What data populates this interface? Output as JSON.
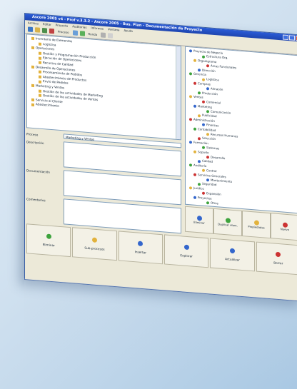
{
  "window": {
    "title": "Ascore 2005 v4 - Prof v.3.3.2 - Ascore 2005 - Bus. Plan - Documentación de Proyecto"
  },
  "menubar": [
    "Archivo",
    "Editar",
    "Proyecto",
    "Auditorías",
    "Informes",
    "Ventana",
    "Ayuda"
  ],
  "toolbar": {
    "text1": "Proceso",
    "text2": "Ronda"
  },
  "tree": [
    "Inventario de Elementos",
    "Logística",
    "Operaciones",
    "Gestión y Programación Producción",
    "Ejecución de Operaciones",
    "Recursos de Calidad",
    "Desarrollo de Operaciones",
    "Procesamiento de Pedidos",
    "Abastecimiento de Productos",
    "Envío de Pedidos",
    "Marketing y Ventas",
    "Gestión de las actividades de Marketing",
    "Gestión de las actividades de Ventas",
    "Servicio al Cliente",
    "Abastecimiento"
  ],
  "form": {
    "proceso_label": "Proceso",
    "proceso_value": "Marketing y Ventas",
    "descripcion_label": "Descripción",
    "documentacion_label": "Documentación",
    "comentarios_label": "Comentarios"
  },
  "right_tree": [
    "Proyecto de Negocio",
    "Estructura Org.",
    "Organigrama",
    "Áreas Funcionales",
    "Dirección",
    "Gerencia",
    "Logística",
    "Compras",
    "Almacén",
    "Producción",
    "Ventas",
    "Comercial",
    "Marketing",
    "Comunicación",
    "Publicidad",
    "Administración",
    "Finanzas",
    "Contabilidad",
    "Recursos Humanos",
    "Selección",
    "Formación",
    "Sistemas",
    "Soporte",
    "Desarrollo",
    "Calidad",
    "Auditoría",
    "Control",
    "Servicios Generales",
    "Mantenimiento",
    "Seguridad",
    "Jurídico",
    "Expansión",
    "Proyectos",
    "Otros"
  ],
  "rbtns": [
    "Eliminar",
    "Duplicar elem.",
    "Propiedades",
    "Nuevo"
  ],
  "bbar": [
    "Eliminar",
    "Sub-procesos",
    "Insertar",
    "Explorar",
    "Actualizar",
    "Borrar"
  ],
  "colors": {
    "titlebar": "#1e45b0",
    "folder": "#e2b23c",
    "green": "#3da33d",
    "red": "#cc3333",
    "blue": "#3366cc"
  }
}
